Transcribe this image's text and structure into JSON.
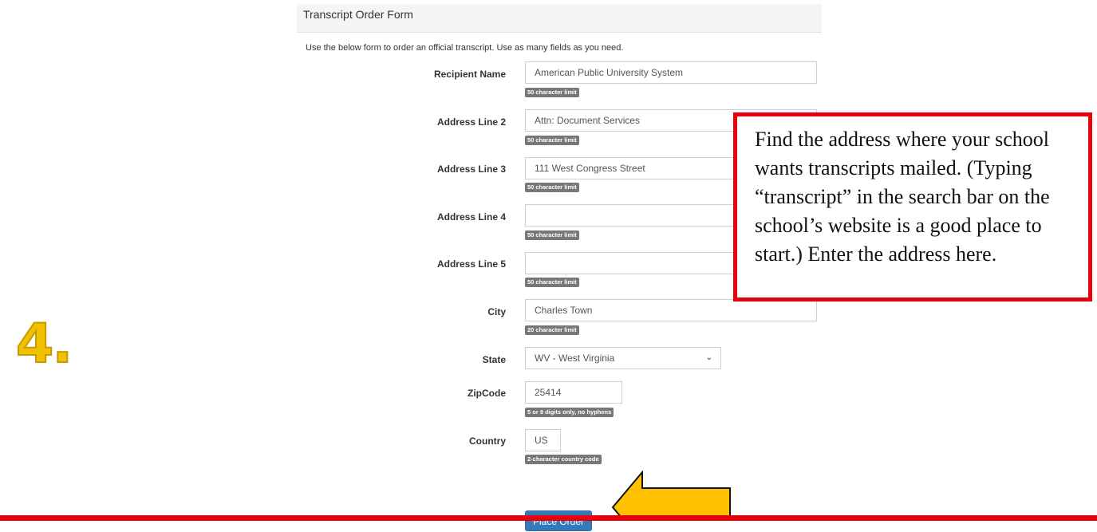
{
  "panel": {
    "title": "Transcript Order Form"
  },
  "intro_text": "Use the below form to order an official transcript. Use as many fields as you need.",
  "fields": [
    {
      "label": "Recipient Name",
      "value": "American Public University System",
      "hint": "50 character limit"
    },
    {
      "label": "Address Line 2",
      "value": "Attn: Document Services",
      "hint": "50 character limit"
    },
    {
      "label": "Address Line 3",
      "value": "111 West Congress Street",
      "hint": "50 character limit"
    },
    {
      "label": "Address Line 4",
      "value": "",
      "hint": "50 character limit"
    },
    {
      "label": "Address Line 5",
      "value": "",
      "hint": "50 character limit"
    },
    {
      "label": "City",
      "value": "Charles Town",
      "hint": "20 character limit"
    },
    {
      "label": "State",
      "value": "WV - West Virginia"
    },
    {
      "label": "ZipCode",
      "value": "25414",
      "hint": "5 or 9 digits only, no hyphens"
    },
    {
      "label": "Country",
      "value": "US",
      "hint": "2-character country code"
    }
  ],
  "place_order_label": "Place Order",
  "step_number": "4.",
  "callout_text": "Find the address where your school wants transcripts mailed. (Typing “transcript” in the search bar on the school’s website is a good place to start.) Enter the address here.",
  "colors": {
    "callout_border": "#e8000d",
    "arrow_fill": "#ffc000",
    "button": "#337ab7",
    "hint_badge": "#777777",
    "step_number": "#f2c200"
  }
}
